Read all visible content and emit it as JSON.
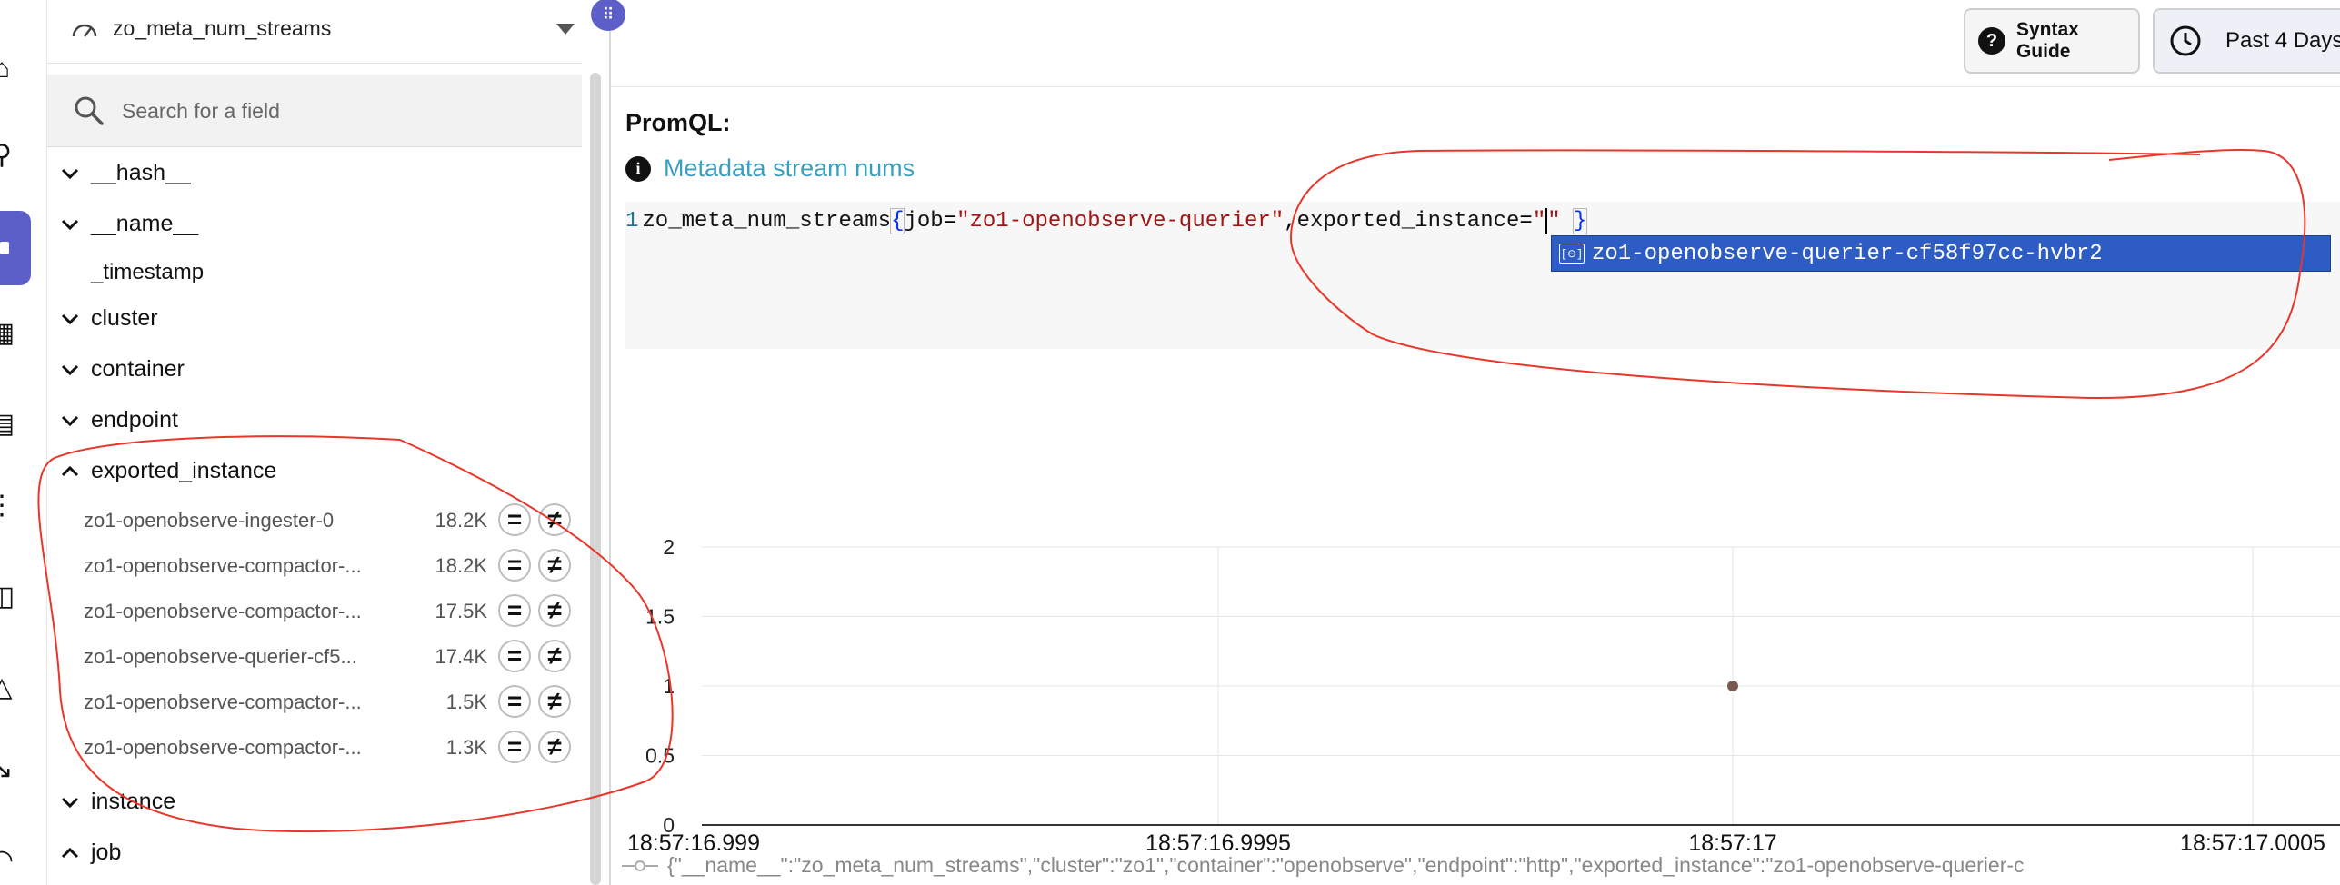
{
  "stream_selector": {
    "value": "zo_meta_num_streams"
  },
  "field_search": {
    "placeholder": "Search for a field"
  },
  "fields": {
    "hash": "__hash__",
    "name": "__name__",
    "timestamp": "_timestamp",
    "cluster": "cluster",
    "container": "container",
    "endpoint": "endpoint",
    "exported_instance": "exported_instance",
    "instance": "instance",
    "job": "job"
  },
  "exported_instance_values": [
    {
      "name": "zo1-openobserve-ingester-0",
      "count": "18.2K"
    },
    {
      "name": "zo1-openobserve-compactor-...",
      "count": "18.2K"
    },
    {
      "name": "zo1-openobserve-compactor-...",
      "count": "17.5K"
    },
    {
      "name": "zo1-openobserve-querier-cf5...",
      "count": "17.4K"
    },
    {
      "name": "zo1-openobserve-compactor-...",
      "count": "1.5K"
    },
    {
      "name": "zo1-openobserve-compactor-...",
      "count": "1.3K"
    }
  ],
  "filter_buttons": {
    "equals": "=",
    "not_equals": "≠"
  },
  "toolbar": {
    "syntax_guide": "Syntax Guide",
    "date_range": "Past 4 Days"
  },
  "query": {
    "label": "PromQL:",
    "metadata_title": "Metadata stream nums",
    "line_number": "1",
    "metric": "zo_meta_num_streams",
    "open_brace": "{",
    "key1": "job",
    "eq1": "=",
    "val1": "\"zo1-openobserve-querier\"",
    "comma": ",",
    "key2": "exported_instance",
    "eq2": "=",
    "val2_open": "\"",
    "val2_close": "\" ",
    "close_brace": "}"
  },
  "autocomplete": {
    "suggestion": "zo1-openobserve-querier-cf58f97cc-hvbr2"
  },
  "chart_data": {
    "type": "scatter",
    "x_ticks": [
      "18:57:16.999",
      "18:57:16.9995",
      "18:57:17",
      "18:57:17.0005"
    ],
    "y_ticks": [
      "0",
      "0.5",
      "1",
      "1.5",
      "2"
    ],
    "ylim": [
      0,
      2
    ],
    "grid": true,
    "series": [
      {
        "x": [
          "18:57:17"
        ],
        "values": [
          1
        ],
        "color": "#7a5a4e"
      }
    ],
    "legend_text": "{\"__name__\":\"zo_meta_num_streams\",\"cluster\":\"zo1\",\"container\":\"openobserve\",\"endpoint\":\"http\",\"exported_instance\":\"zo1-openobserve-querier-c"
  },
  "colors": {
    "accent": "#5b5fc7",
    "link": "#3a9fbf",
    "annotation": "#e8372a",
    "suggestion_bg": "#2d5cc4"
  }
}
